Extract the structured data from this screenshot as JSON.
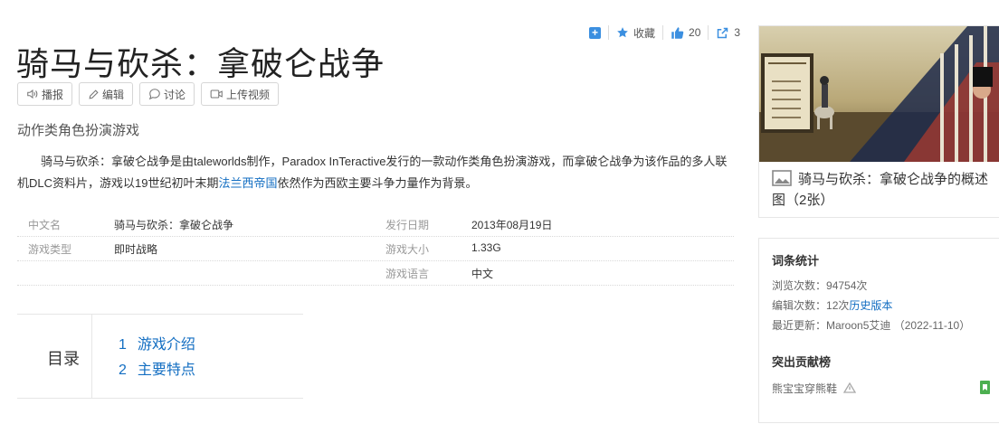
{
  "actions": {
    "favorite_label": "收藏",
    "like_count": "20",
    "share_count": "3"
  },
  "title": "骑马与砍杀：拿破仑战争",
  "buttons": {
    "read": "播报",
    "edit": "编辑",
    "discuss": "讨论",
    "upload": "上传视频"
  },
  "subtitle": "动作类角色扮演游戏",
  "summary": {
    "p1": "骑马与砍杀：拿破仑战争是由taleworlds制作，Paradox InTeractive发行的一款动作类角色扮演游戏，而拿破仑战争为该作品的多人联机DLC资料片，游戏以19世纪初叶末期",
    "link": "法兰西帝国",
    "p2": "依然作为西欧主要斗争力量作为背景。"
  },
  "info": [
    {
      "l1": "中文名",
      "v1": "骑马与砍杀：拿破仑战争",
      "l2": "发行日期",
      "v2": "2013年08月19日"
    },
    {
      "l1": "游戏类型",
      "v1": "即时战略",
      "l2": "游戏大小",
      "v2": "1.33G"
    },
    {
      "l1": "",
      "v1": "",
      "l2": "游戏语言",
      "v2": "中文"
    }
  ],
  "toc": {
    "title": "目录",
    "items": [
      {
        "num": "1",
        "label": "游戏介绍"
      },
      {
        "num": "2",
        "label": "主要特点"
      }
    ]
  },
  "album": {
    "caption": "骑马与砍杀：拿破仑战争的概述图（2张）"
  },
  "stats": {
    "heading": "词条统计",
    "views_label": "浏览次数：",
    "views": "94754次",
    "edits_label": "编辑次数：",
    "edits": "12次",
    "history_link": "历史版本",
    "updated_label": "最近更新：",
    "updated_user": "Maroon5艾迪",
    "updated_date": "（2022-11-10）",
    "contrib_heading": "突出贡献榜",
    "contributor": "熊宝宝穿熊鞋"
  },
  "colors": {
    "link": "#136ec2",
    "accent": "#3b8fe0"
  }
}
